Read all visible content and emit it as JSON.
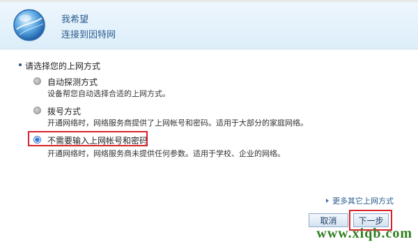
{
  "header": {
    "title": "我希望",
    "subtitle": "连接到因特网",
    "icon": "globe-icon"
  },
  "section": {
    "title": "请选择您的上网方式"
  },
  "options": [
    {
      "label": "自动探测方式",
      "desc": "设备帮您自动选择合适的上网方式。",
      "selected": false
    },
    {
      "label": "拨号方式",
      "desc": "开通网络时，网络服务商提供了上网帐号和密码。适用于大部分的家庭网络。",
      "selected": false
    },
    {
      "label": "不需要输入上网帐号和密码",
      "desc": "开通网络时，网络服务商未提供任何参数。适用于学校、企业的网络。",
      "selected": true
    }
  ],
  "more_link": "更多其它上网方式",
  "buttons": {
    "cancel": "取消",
    "next": "下一步"
  },
  "watermark": "www.xiqb.com",
  "colors": {
    "highlight": "#d8222a",
    "accent": "#2a5c8f",
    "header_bg": "#dceefa"
  }
}
